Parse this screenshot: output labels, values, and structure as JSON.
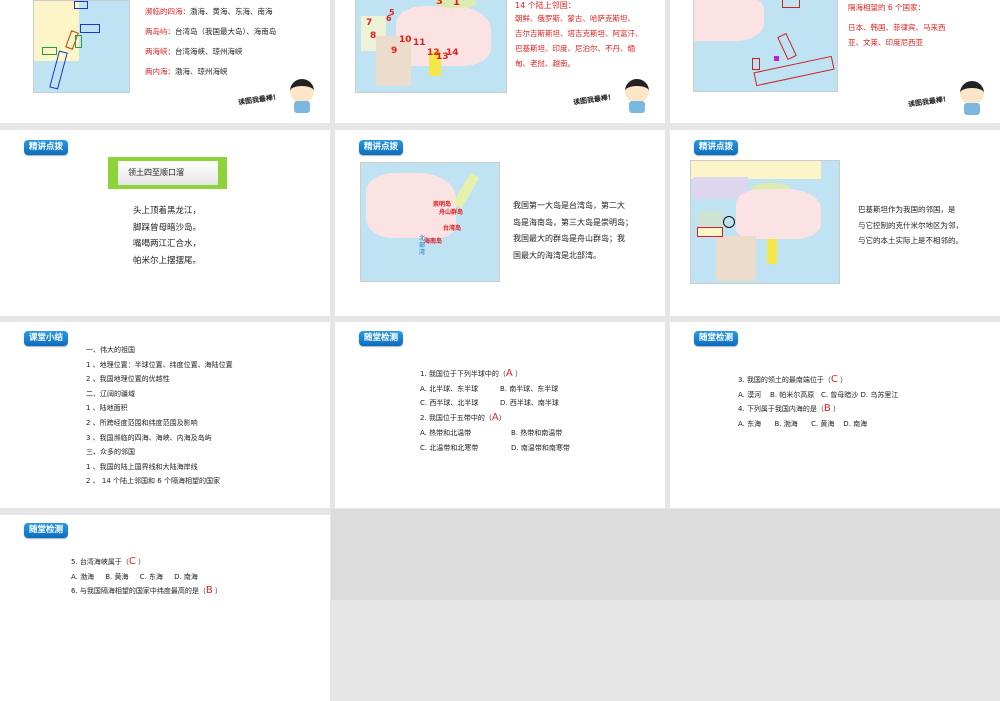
{
  "slides": [
    {
      "lines": [
        {
          "label": "濒临的四海：",
          "text": "渤海、黄海、东海、南海"
        },
        {
          "label": "两岛屿：",
          "text": "台湾岛（我国最大岛）、海南岛"
        },
        {
          "label": "两海峡：",
          "text": "台湾海峡、琼州海峡"
        },
        {
          "label": "两内海：",
          "text": "渤海、琼州海峡"
        }
      ],
      "cartoon_text": "读图我最棒!"
    },
    {
      "heading": "14 个陆上邻国：",
      "lines": [
        "朝鲜、俄罗斯、蒙古、哈萨克斯坦、",
        "吉尔吉斯斯坦、塔吉克斯坦、阿富汗、",
        "巴基斯坦、印度、尼泊尔、不丹、缅",
        "甸、老挝、越南。"
      ],
      "map_numbers": [
        "1",
        "3",
        "5",
        "6",
        "7",
        "8",
        "9",
        "10",
        "11",
        "12",
        "13",
        "14"
      ],
      "cartoon_text": "读图我最棒!"
    },
    {
      "heading": "隔海相望的 6 个国家：",
      "lines": [
        "日本、韩国、菲律宾、马来西",
        "亚、文莱、印度尼西亚"
      ],
      "cartoon_text": "读图我最棒!"
    },
    {
      "badge": "精讲点拨",
      "banner": "领土四至顺口溜",
      "lines": [
        "头上顶着黑龙江，",
        "脚踩曾母暗沙岛。",
        "嘴喝两江汇合水，",
        "帕米尔上摆摆尾。"
      ]
    },
    {
      "badge": "精讲点拨",
      "map_labels": [
        "崇明岛",
        "舟山群岛",
        "台湾岛",
        "海南岛",
        "北部湾"
      ],
      "lines": [
        "我国第一大岛是台湾岛，第二大",
        "岛是海南岛，第三大岛是崇明岛；",
        "我国最大的群岛是舟山群岛；我",
        "国最大的海湾是北部湾。"
      ]
    },
    {
      "badge": "精讲点拨",
      "lines": [
        "巴基斯坦作为我国的邻国，是",
        "与它控制的克什米尔地区为邻，",
        "与它的本土实际上是不相邻的。"
      ]
    },
    {
      "badge": "课堂小结",
      "lines": [
        "一、伟大的祖国",
        "1 、地理位置：半球位置、纬度位置、海陆位置",
        "2 、我国地理位置的优越性",
        "二、辽阔的疆域",
        "1 、陆地面积",
        "2 、所跨经度范围和纬度范围及影响",
        "3 、我国濒临的四海、海峡、内海及岛屿",
        "三、众多的邻国",
        "1 、我国的陆上国界线和大陆海岸线",
        "2 、 14 个陆上邻国和 6 个隔海相望的国家"
      ]
    },
    {
      "badge": "随堂检测",
      "q1": {
        "text": "1. 我国位于下列半球中的（",
        "answer": "A",
        "close": " ）"
      },
      "q1_opts": [
        "A. 北半球、东半球",
        "B. 南半球、东半球",
        "C. 西半球、北半球",
        "D. 西半球、南半球"
      ],
      "q2": {
        "text": "2. 我国位于五带中的（",
        "answer": "A",
        "close": "）"
      },
      "q2_opts": [
        "A. 热带和北温带",
        "B. 热带和南温带",
        "C. 北温带和北寒带",
        "D. 南温带和南寒带"
      ]
    },
    {
      "badge": "随堂检测",
      "q3": {
        "text": "3. 我国的领土的最南端位于（",
        "answer": "C",
        "close": "  ）"
      },
      "q3_opts": "A. 漠河    B. 帕米尔高原   C. 曾母暗沙 D. 乌苏里江",
      "q4": {
        "text": "4. 下列属于我国内海的是（",
        "answer": "B",
        "close": " ）"
      },
      "q4_opts": "A. 东海      B. 渤海      C. 黄海    D. 南海"
    },
    {
      "badge": "随堂检测",
      "q5": {
        "text": "5. 台湾海峡属于（",
        "answer": "C",
        "close": " ）"
      },
      "q5_opts": "A. 渤海     B. 黄海     C. 东海     D. 南海",
      "q6": {
        "text": "6. 与我国隔海相望的国家中纬度最高的是（",
        "answer": "B",
        "close": " ）"
      }
    }
  ],
  "colors": {
    "accent_red": "#e02020",
    "badge_blue": "#0a6cbf",
    "banner_green": "#8ed33a"
  }
}
